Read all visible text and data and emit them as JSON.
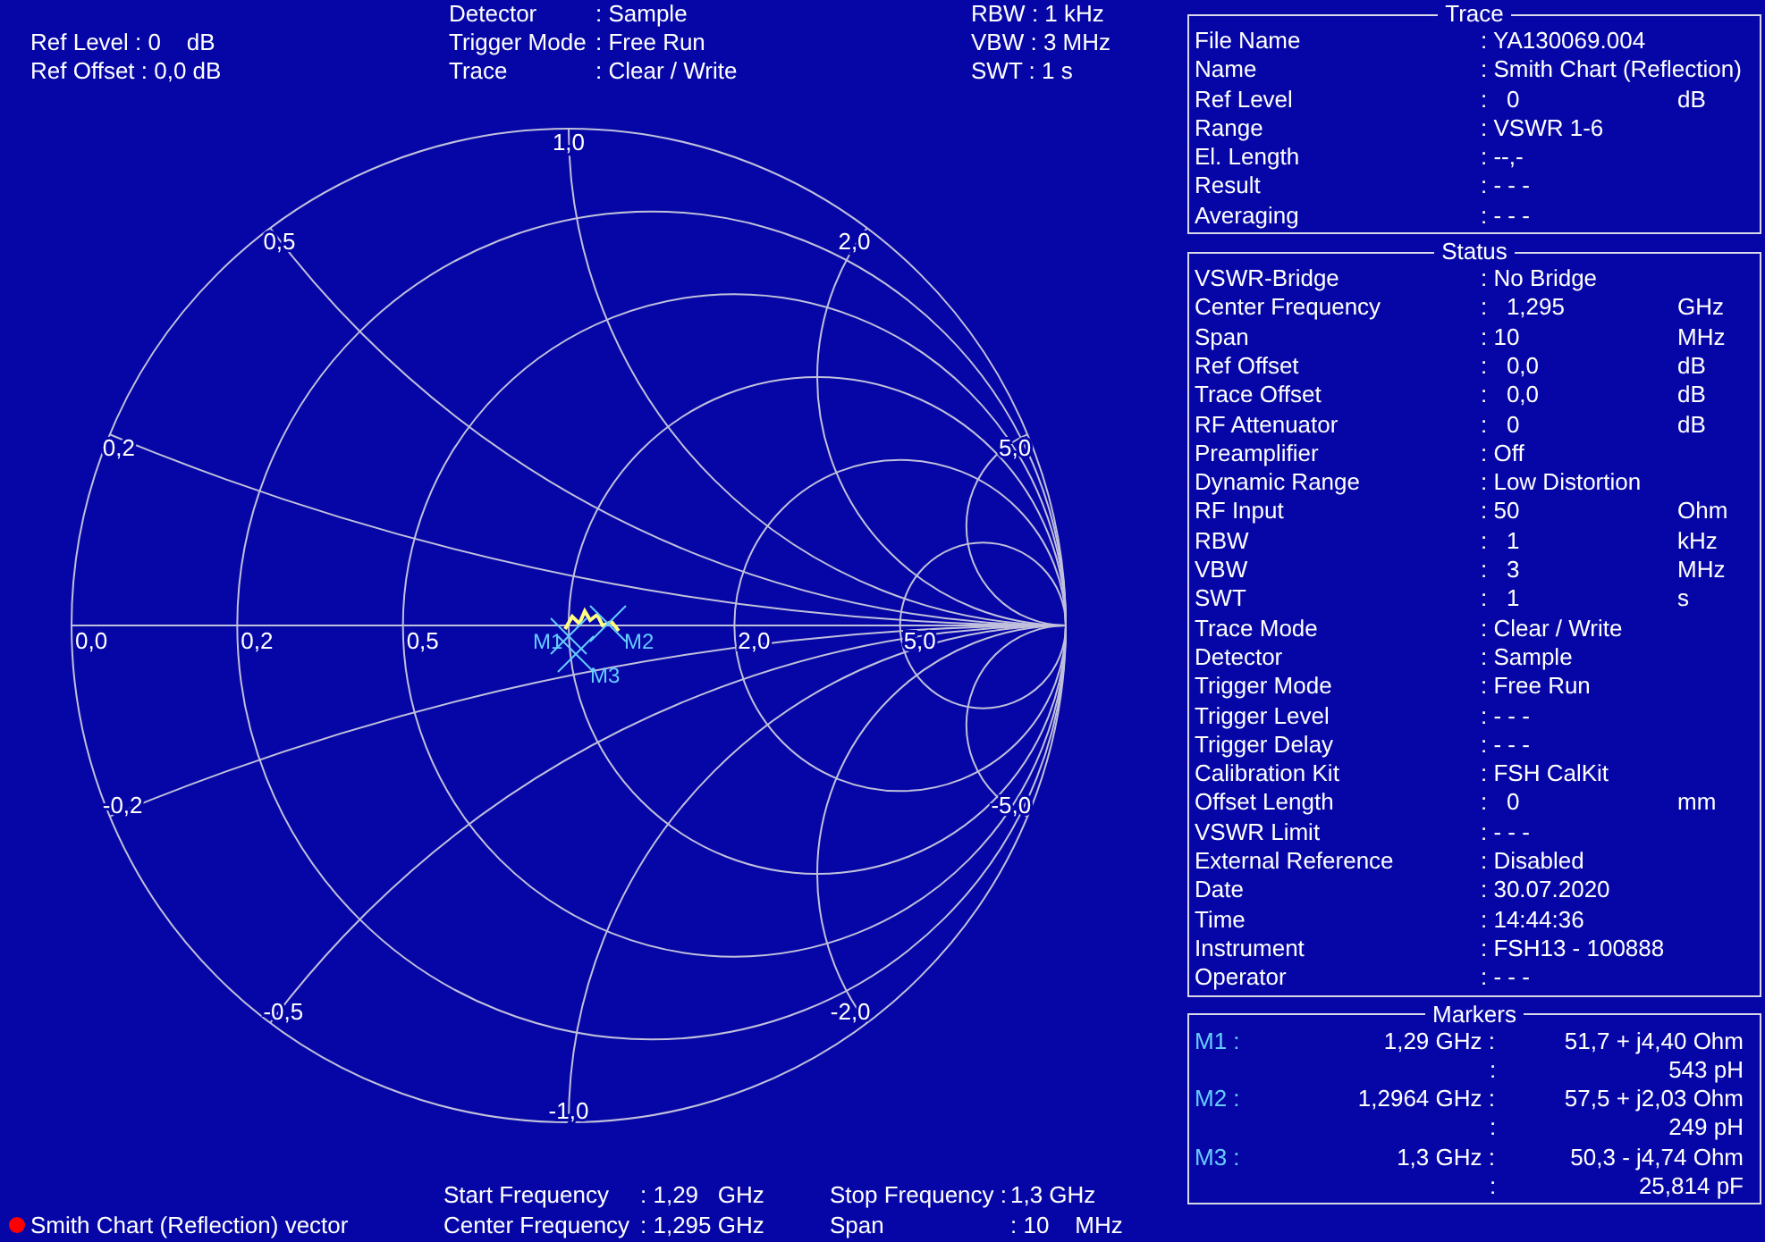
{
  "header": {
    "left": [
      "Ref Level : 0    dB",
      "Ref Offset : 0,0 dB"
    ],
    "middle": [
      {
        "label": "Detector",
        "value": ": Sample"
      },
      {
        "label": "Trigger Mode",
        "value": ": Free Run"
      },
      {
        "label": "Trace",
        "value": ": Clear / Write"
      }
    ],
    "right": [
      "RBW : 1 kHz",
      "VBW : 3 MHz",
      "SWT : 1 s"
    ]
  },
  "smith_chart": {
    "resistance_labels": [
      "0,0",
      "0,2",
      "0,5",
      "2,0",
      "5,0"
    ],
    "reactance_labels": [
      "0,2",
      "0,5",
      "1,0",
      "2,0",
      "5,0",
      "-0,2",
      "-0,5",
      "-1,0",
      "-2,0",
      "-5,0"
    ],
    "marker_labels": [
      "M1",
      "M2",
      "M3"
    ]
  },
  "footer": {
    "legend": {
      "label": "Smith Chart (Reflection) vector",
      "color": "#ff0000"
    },
    "left": [
      {
        "label": "Start Frequency",
        "value": ": 1,29   GHz"
      },
      {
        "label": "Center Frequency",
        "value": ": 1,295 GHz"
      }
    ],
    "right": [
      {
        "label": "Stop Frequency :",
        "value": "1,3 GHz"
      },
      {
        "label": "Span",
        "value": ": 10    MHz"
      }
    ]
  },
  "sections": [
    {
      "title": "Trace",
      "rows": [
        {
          "label": "File Name",
          "value": ": YA130069.004"
        },
        {
          "label": "Name",
          "value": ": Smith Chart (Reflection)"
        },
        {
          "label": "Ref Level",
          "value": ":   0",
          "unit": "dB"
        },
        {
          "label": "Range",
          "value": ": VSWR 1-6"
        },
        {
          "label": "El. Length",
          "value": ": --,-"
        },
        {
          "label": "Result",
          "value": ": - - -"
        },
        {
          "label": "Averaging",
          "value": ": - - -"
        }
      ]
    },
    {
      "title": "Status",
      "rows": [
        {
          "label": "VSWR-Bridge",
          "value": ": No Bridge"
        },
        {
          "label": "Center Frequency",
          "value": ":   1,295",
          "unit": "GHz"
        },
        {
          "label": "Span",
          "value": ": 10",
          "unit": "MHz"
        },
        {
          "label": "Ref Offset",
          "value": ":   0,0",
          "unit": "dB"
        },
        {
          "label": "Trace Offset",
          "value": ":   0,0",
          "unit": "dB"
        },
        {
          "label": "RF Attenuator",
          "value": ":   0",
          "unit": "dB"
        },
        {
          "label": "Preamplifier",
          "value": ": Off"
        },
        {
          "label": "Dynamic Range",
          "value": ": Low Distortion"
        },
        {
          "label": "RF Input",
          "value": ": 50",
          "unit": "Ohm"
        },
        {
          "label": "RBW",
          "value": ":   1",
          "unit": "kHz"
        },
        {
          "label": "VBW",
          "value": ":   3",
          "unit": "MHz"
        },
        {
          "label": "SWT",
          "value": ":   1",
          "unit": "s"
        },
        {
          "label": "Trace Mode",
          "value": ": Clear / Write"
        },
        {
          "label": "Detector",
          "value": ": Sample"
        },
        {
          "label": "Trigger Mode",
          "value": ": Free Run"
        },
        {
          "label": "Trigger Level",
          "value": ": - - -"
        },
        {
          "label": "Trigger Delay",
          "value": ": - - -"
        },
        {
          "label": "Calibration Kit",
          "value": ": FSH CalKit"
        },
        {
          "label": "Offset Length",
          "value": ":   0",
          "unit": "mm"
        },
        {
          "label": "VSWR Limit",
          "value": ": - - -"
        },
        {
          "label": "External Reference",
          "value": ": Disabled"
        },
        {
          "label": "Date",
          "value": ": 30.07.2020"
        },
        {
          "label": "Time",
          "value": ": 14:44:36"
        },
        {
          "label": "Instrument",
          "value": ": FSH13 - 100888"
        },
        {
          "label": "Operator",
          "value": ": - - -"
        }
      ]
    }
  ],
  "markers": {
    "title": "Markers",
    "rows": [
      {
        "name": "M1 :",
        "frequency": "1,29 GHz :",
        "value": "51,7 + j4,40 Ohm",
        "lead": ":",
        "detail": "543 pH"
      },
      {
        "name": "M2 :",
        "frequency": "1,2964 GHz :",
        "value": "57,5 + j2,03 Ohm",
        "lead": ":",
        "detail": "249 pH"
      },
      {
        "name": "M3 :",
        "frequency": "1,3 GHz :",
        "value": "50,3 - j4,74 Ohm",
        "lead": ":",
        "detail": "25,814 pF"
      }
    ]
  }
}
